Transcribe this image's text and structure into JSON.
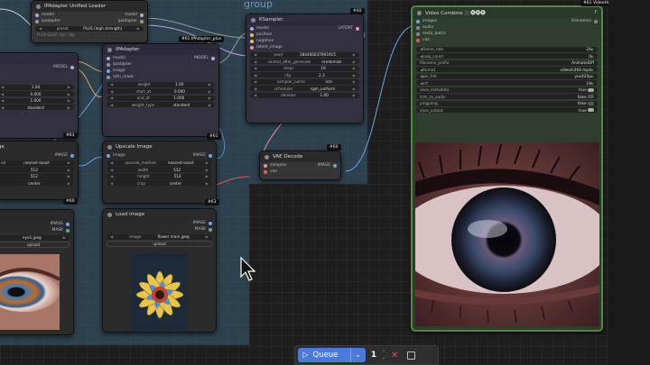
{
  "colors": {
    "queue_accent": "#4a7bd8",
    "group_bg": "#3c5f78",
    "video_node_border": "#4f8a45"
  },
  "group": {
    "title": "group",
    "badge_ksampler": "#40",
    "badge_right": "#40"
  },
  "ipadapter_unified_loader": {
    "title": "IPAdapter Unified Loader",
    "inputs": [
      "model",
      "ipadapter"
    ],
    "outputs": [
      "model",
      "ipadapter"
    ],
    "preset_label": "preset",
    "preset_value": "PLUS (high strength)",
    "wire_label": "FLUX GGUF clip / clip",
    "badge_chip": "#61 IPAdapter_plus"
  },
  "ipadapter": {
    "title": "IPAdapter",
    "inputs": [
      "model",
      "ipadapter",
      "image",
      "attn_mask"
    ],
    "output": "MODEL",
    "widgets": [
      {
        "label": "weight",
        "value": "1.00"
      },
      {
        "label": "start_at",
        "value": "0.000"
      },
      {
        "label": "end_at",
        "value": "1.000"
      },
      {
        "label": "weight_type",
        "value": "standard"
      }
    ],
    "badge": "#61"
  },
  "left_node": {
    "output": "MODEL",
    "widgets": [
      {
        "label": "",
        "value": "1.00"
      },
      {
        "label": "",
        "value": "0.000"
      },
      {
        "label": "",
        "value": "1.000"
      },
      {
        "label": "",
        "value": "standard"
      }
    ],
    "badge": "#63"
  },
  "left_upscale": {
    "title": "ge",
    "output": "IMAGE",
    "widgets": [
      {
        "label": "od",
        "value": "nearest-exact"
      },
      {
        "label": "",
        "value": "512"
      },
      {
        "label": "",
        "value": "512"
      },
      {
        "label": "",
        "value": "center"
      }
    ],
    "badge": "#60"
  },
  "left_load": {
    "outputs": [
      "IMAGE",
      "MASK"
    ],
    "image_value": "eye1.jpeg",
    "upload_label": "upload"
  },
  "upscale_image": {
    "title": "Upscale Image",
    "input": "image",
    "output": "IMAGE",
    "widgets": [
      {
        "label": "upscale_method",
        "value": "nearest-exact"
      },
      {
        "label": "width",
        "value": "512"
      },
      {
        "label": "height",
        "value": "512"
      },
      {
        "label": "crop",
        "value": "center"
      }
    ],
    "badge": "#63"
  },
  "load_image": {
    "title": "Load Image",
    "outputs": [
      "IMAGE",
      "MASK"
    ],
    "image_label": "image",
    "image_value": "flower main.jpeg",
    "upload_label": "upload"
  },
  "ksampler": {
    "title": "KSampler",
    "inputs": [
      "model",
      "positive",
      "negative",
      "latent_image"
    ],
    "output": "LATENT",
    "widgets": [
      {
        "label": "seed",
        "value": "384466037901915"
      },
      {
        "label": "control_after_generate",
        "value": "randomize"
      },
      {
        "label": "steps",
        "value": "16"
      },
      {
        "label": "cfg",
        "value": "2.3"
      },
      {
        "label": "sampler_name",
        "value": "lcm"
      },
      {
        "label": "scheduler",
        "value": "sgm_uniform"
      },
      {
        "label": "denoise",
        "value": "1.00"
      }
    ]
  },
  "vae_decode": {
    "title": "VAE Decode",
    "inputs": [
      "samples",
      "vae"
    ],
    "output": "IMAGE",
    "badge": "#60"
  },
  "video_combine": {
    "title": "Video Combine 🎥🅥🅗🅢",
    "help": "?",
    "inputs": [
      "images",
      "audio",
      "meta_batch",
      "vae"
    ],
    "output": "Filenames",
    "widgets": [
      {
        "label": "frame_rate",
        "value": "24"
      },
      {
        "label": "loop_count",
        "value": "0"
      },
      {
        "label": "filename_prefix",
        "value": "AnimateDiff"
      },
      {
        "label": "format",
        "value": "video/h264-mp4"
      },
      {
        "label": "pix_fmt",
        "value": "yuv420p"
      },
      {
        "label": "crf",
        "value": "19"
      },
      {
        "label": "save_metadata",
        "value": "true"
      },
      {
        "label": "trim_to_audio",
        "value": "false"
      },
      {
        "label": "pingpong",
        "value": "false"
      },
      {
        "label": "save_output",
        "value": "true"
      }
    ],
    "badge_chip": "#61 VideoHelperSuite"
  },
  "queue": {
    "label": "Queue",
    "count": "1",
    "play_icon": "play-icon",
    "dropdown_icon": "chevron-down-icon",
    "cancel_icon": "close-icon",
    "stop_icon": "stop-icon"
  }
}
